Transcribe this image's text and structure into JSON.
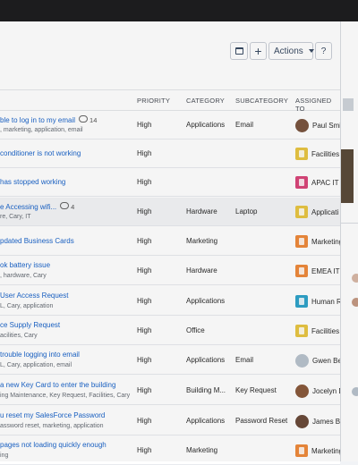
{
  "toolbar": {
    "actions_label": "Actions",
    "help_label": "?",
    "add_label": "+"
  },
  "columns": {
    "priority": "PRIORITY",
    "category": "CATEGORY",
    "subcategory": "SUBCATEGORY",
    "assigned_to": "ASSIGNED TO"
  },
  "rows": [
    {
      "subject": "ble to log in to my email",
      "comments": "14",
      "tags": ", marketing, application, email",
      "priority": "High",
      "category": "Applications",
      "subcategory": "Email",
      "assigned": "Paul Smit",
      "avatar": "#7a5540",
      "kind": "person"
    },
    {
      "subject": "conditioner is not working",
      "comments": "",
      "tags": "",
      "priority": "High",
      "category": "",
      "subcategory": "",
      "assigned": "Facilities",
      "avatar": "#e8c543",
      "kind": "queue"
    },
    {
      "subject": "has stopped working",
      "comments": "",
      "tags": "",
      "priority": "High",
      "category": "",
      "subcategory": "",
      "assigned": "APAC IT A",
      "avatar": "#d9467a",
      "kind": "queue"
    },
    {
      "subject": "e Accessing wifi...",
      "comments": "4",
      "tags": "re, Cary, IT",
      "priority": "High",
      "category": "Hardware",
      "subcategory": "Laptop",
      "assigned": "Applicati",
      "avatar": "#e8c543",
      "kind": "queue"
    },
    {
      "subject": "pdated Business Cards",
      "comments": "",
      "tags": "",
      "priority": "High",
      "category": "Marketing",
      "subcategory": "",
      "assigned": "Marketing",
      "avatar": "#ee8a3c",
      "kind": "queue"
    },
    {
      "subject": "ok battery issue",
      "comments": "",
      "tags": ", hardware, Cary",
      "priority": "High",
      "category": "Hardware",
      "subcategory": "",
      "assigned": "EMEA IT A",
      "avatar": "#ee8a3c",
      "kind": "queue"
    },
    {
      "subject": "User Access Request",
      "comments": "",
      "tags": "L, Cary, application",
      "priority": "High",
      "category": "Applications",
      "subcategory": "",
      "assigned": "Human R",
      "avatar": "#2fa3c9",
      "kind": "queue"
    },
    {
      "subject": "ce Supply Request",
      "comments": "",
      "tags": "acilities, Cary",
      "priority": "High",
      "category": "Office",
      "subcategory": "",
      "assigned": "Facilities",
      "avatar": "#e8c543",
      "kind": "queue"
    },
    {
      "subject": "trouble logging into email",
      "comments": "",
      "tags": "L, Cary, application, email",
      "priority": "High",
      "category": "Applications",
      "subcategory": "Email",
      "assigned": "Gwen Be",
      "avatar": "#b8c2cc",
      "kind": "person"
    },
    {
      "subject": "a new Key Card to enter the building",
      "comments": "",
      "tags": "ing Maintenance, Key Request, Facilities, Cary",
      "priority": "High",
      "category": "Building M...",
      "subcategory": "Key Request",
      "assigned": "Jocelyn D",
      "avatar": "#8a5a3c",
      "kind": "person"
    },
    {
      "subject": "u reset my SalesForce Password",
      "comments": "",
      "tags": "assword reset, marketing, application",
      "priority": "High",
      "category": "Applications",
      "subcategory": "Password Reset",
      "assigned": "James Bla",
      "avatar": "#6b4a3a",
      "kind": "person"
    },
    {
      "subject": "pages not loading quickly enough",
      "comments": "",
      "tags": "ing",
      "priority": "High",
      "category": "Marketing",
      "subcategory": "",
      "assigned": "Marketing",
      "avatar": "#ee8a3c",
      "kind": "queue"
    }
  ]
}
